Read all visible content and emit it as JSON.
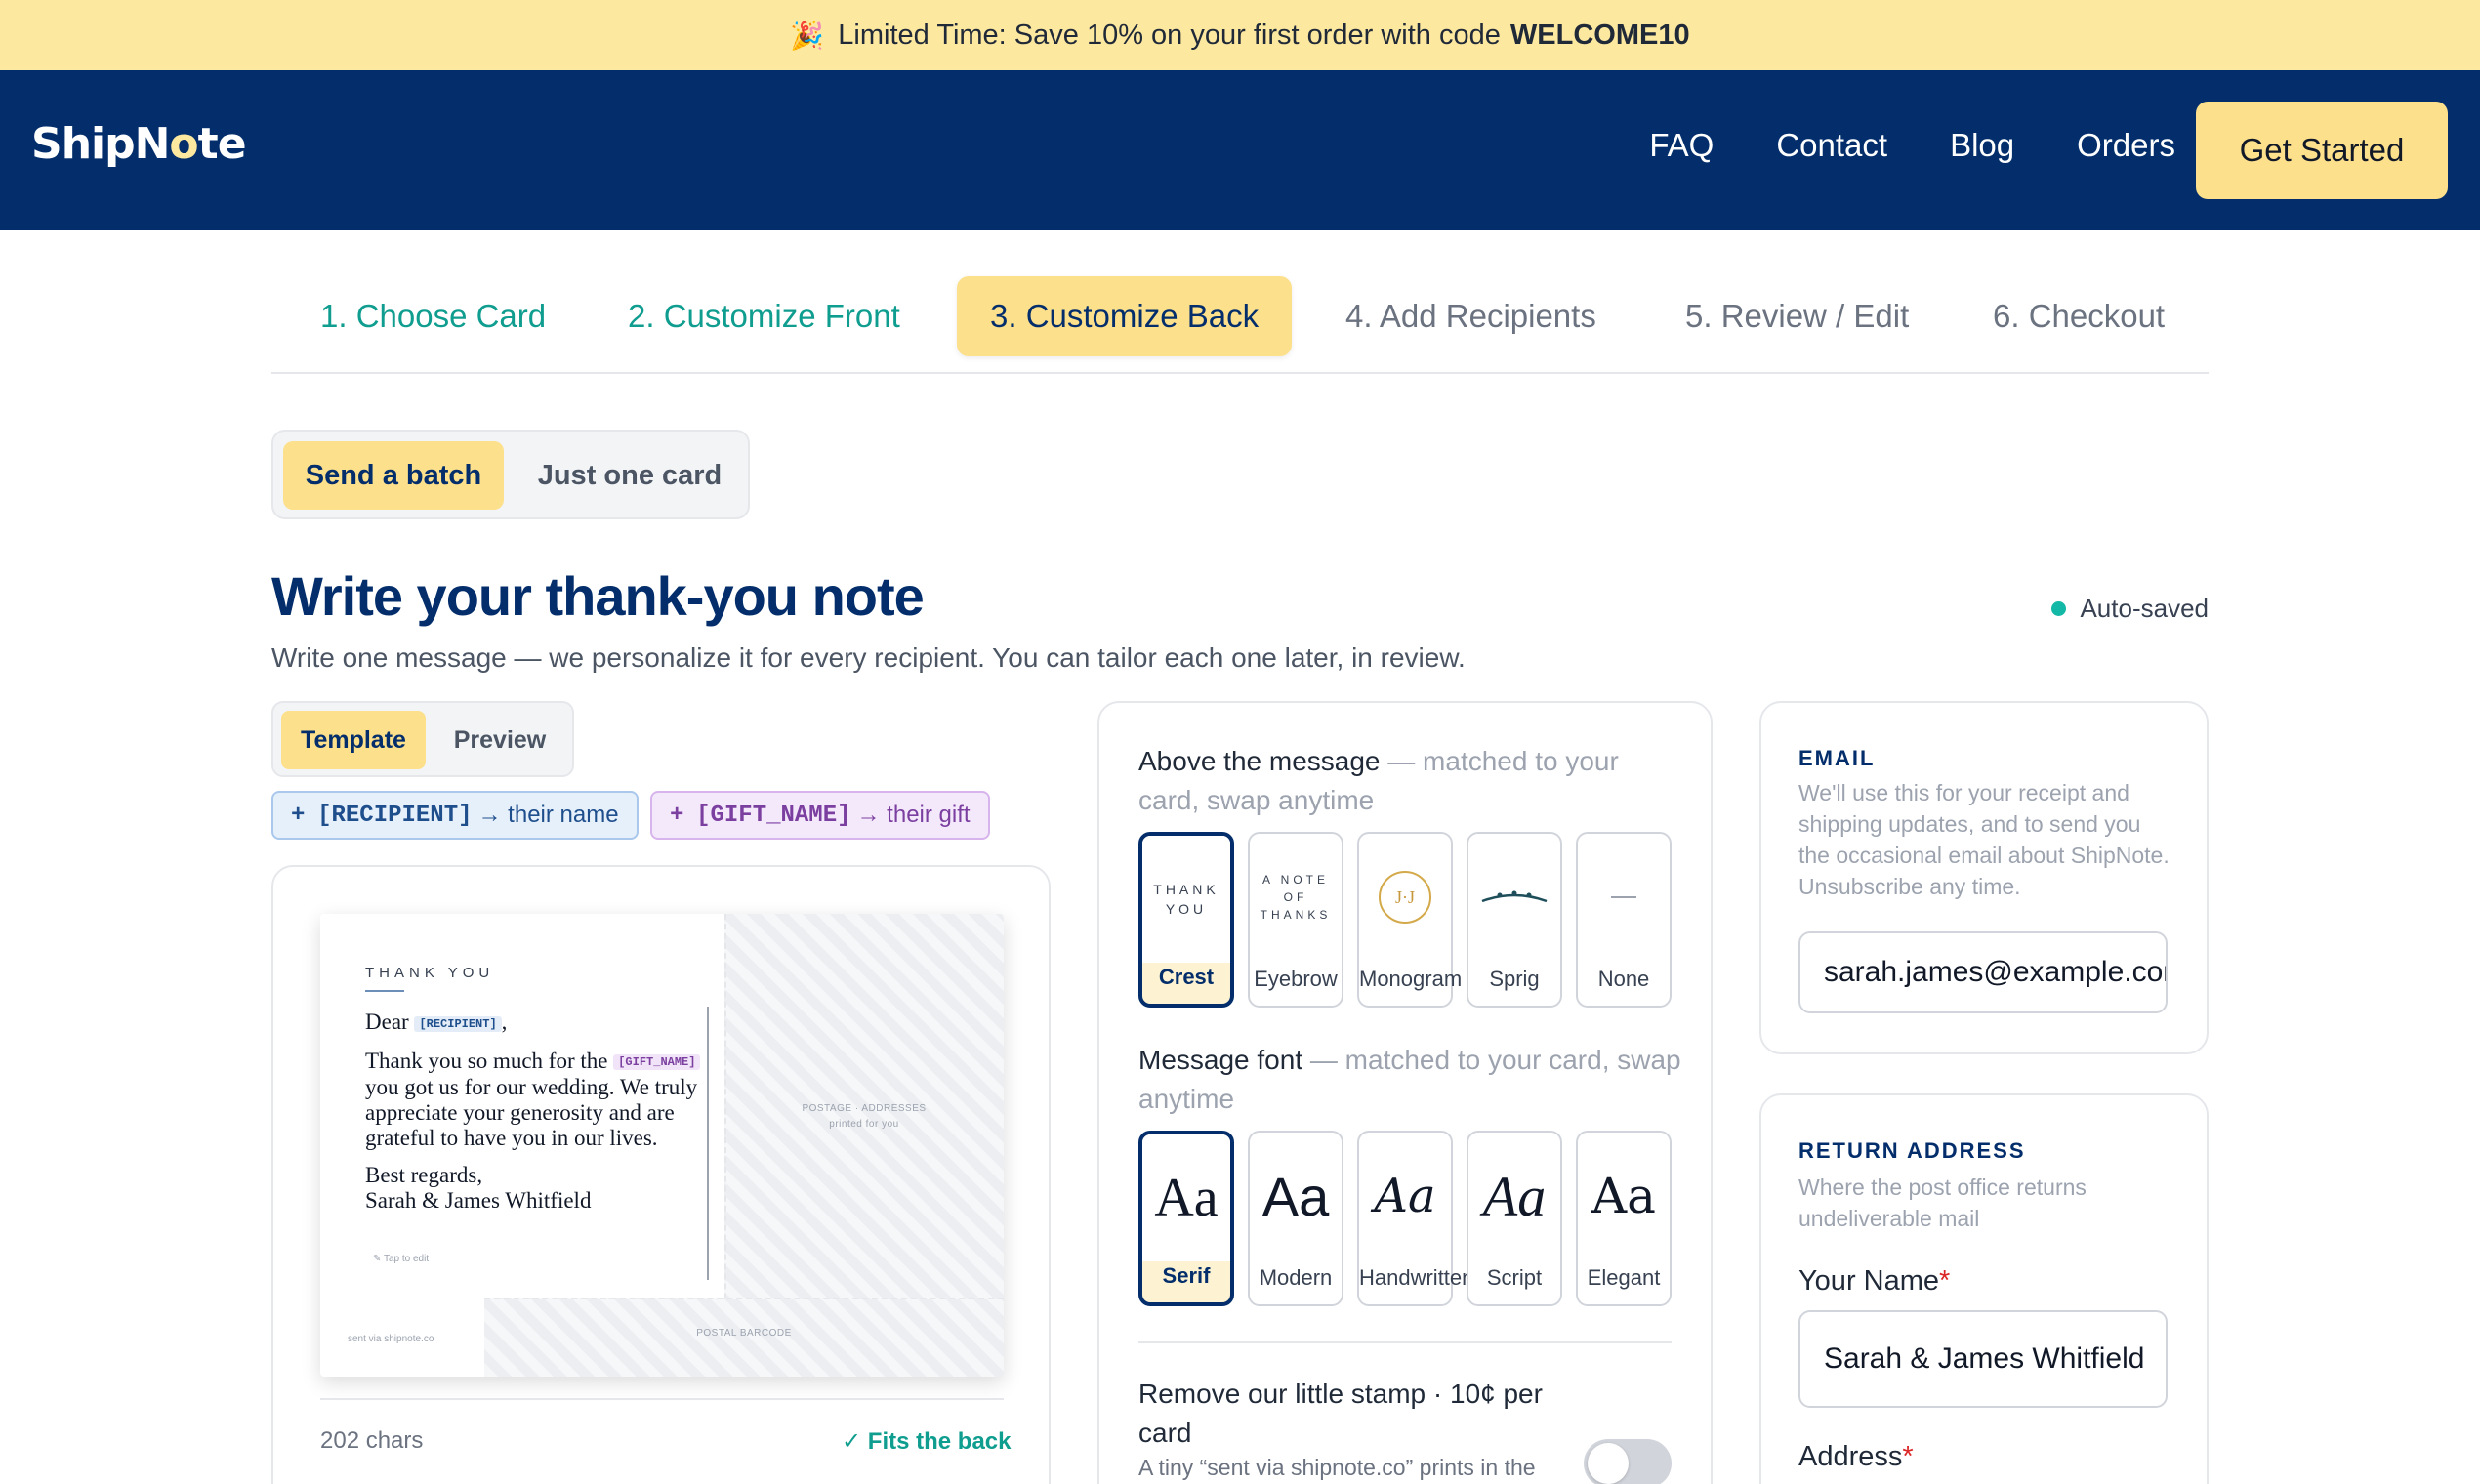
{
  "promo": {
    "emoji": "🎉",
    "text": "Limited Time: Save 10% on your first order with code",
    "code": "WELCOME10"
  },
  "header": {
    "logo": "ShipNote",
    "nav": [
      "FAQ",
      "Contact",
      "Blog",
      "Orders"
    ],
    "cta": "Get Started"
  },
  "steps": [
    {
      "label": "1. Choose Card",
      "state": "done"
    },
    {
      "label": "2. Customize Front",
      "state": "done"
    },
    {
      "label": "3. Customize Back",
      "state": "active"
    },
    {
      "label": "4. Add Recipients",
      "state": "todo"
    },
    {
      "label": "5. Review / Edit",
      "state": "todo"
    },
    {
      "label": "6. Checkout",
      "state": "todo"
    }
  ],
  "mode": {
    "batch": "Send a batch",
    "single": "Just one card"
  },
  "page": {
    "title": "Write your thank-you note",
    "subtitle": "Write one message — we personalize it for every recipient. You can tailor each one later, in review.",
    "autosave": "Auto-saved"
  },
  "editor": {
    "tabs": {
      "template": "Template",
      "preview": "Preview"
    },
    "chips": [
      {
        "plus": "+",
        "code": "[RECIPIENT]",
        "desc": "→ their name"
      },
      {
        "plus": "+",
        "code": "[GIFT_NAME]",
        "desc": "→ their gift"
      }
    ],
    "card": {
      "eyebrow": "THANK YOU",
      "dear": "Dear",
      "recipient_token": "[RECIPIENT]",
      "comma": ",",
      "line1": "Thank you so much for the",
      "gift_token": "[GIFT_NAME]",
      "line2": "you got us for our wedding. We truly appreciate your generosity and are grateful to have you in our lives.",
      "closing": "Best regards,",
      "signature": "Sarah & James Whitfield",
      "tap": "✎ Tap to edit",
      "postage": "POSTAGE · ADDRESSES",
      "postage_sub": "printed for you",
      "barcode": "POSTAL BARCODE",
      "sent_via": "sent via shipnote.co"
    },
    "char_count": "202 chars",
    "fits": "✓ Fits the back"
  },
  "above_message": {
    "label": "Above the message",
    "hint": "— matched to your card, swap anytime",
    "options": [
      {
        "name": "Crest",
        "preview": "THANK YOU",
        "selected": true
      },
      {
        "name": "Eyebrow",
        "preview": "A NOTE OF THANKS",
        "selected": false
      },
      {
        "name": "Monogram",
        "preview": "J·J",
        "selected": false
      },
      {
        "name": "Sprig",
        "preview": "",
        "selected": false
      },
      {
        "name": "None",
        "preview": "",
        "selected": false
      }
    ]
  },
  "message_font": {
    "label": "Message font",
    "hint": "— matched to your card, swap anytime",
    "options": [
      {
        "name": "Serif",
        "preview": "Aa",
        "selected": true
      },
      {
        "name": "Modern",
        "preview": "Aa",
        "selected": false
      },
      {
        "name": "Handwritten",
        "preview": "Aa",
        "selected": false
      },
      {
        "name": "Script",
        "preview": "Aa",
        "selected": false
      },
      {
        "name": "Elegant",
        "preview": "Aa",
        "selected": false
      }
    ]
  },
  "stamp": {
    "label": "Remove our little stamp · 10¢ per card",
    "sub": "A tiny “sent via shipnote.co” prints in the",
    "enabled": false
  },
  "email": {
    "heading": "EMAIL",
    "desc": "We'll use this for your receipt and shipping updates, and to send you the occasional email about ShipNote. Unsubscribe any time.",
    "value": "sarah.james@example.com"
  },
  "return_address": {
    "heading": "RETURN ADDRESS",
    "desc": "Where the post office returns undeliverable mail",
    "name_label": "Your Name",
    "name_value": "Sarah & James Whitfield",
    "address_label": "Address",
    "required_mark": "*"
  },
  "colors": {
    "navy": "#032e6b",
    "yellow": "#fde08b",
    "teal": "#0f9d8f"
  }
}
